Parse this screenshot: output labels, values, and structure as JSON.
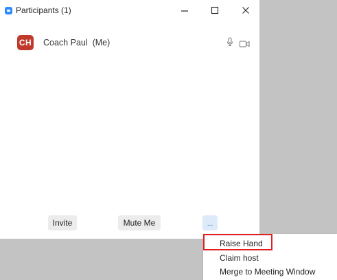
{
  "window": {
    "title": "Participants (1)",
    "controls": {
      "minimize": "minimize-icon",
      "maximize": "maximize-icon",
      "close": "close-icon"
    }
  },
  "participants": [
    {
      "initials": "CH",
      "name": "Coach Paul",
      "tag": "(Me)",
      "display": "Coach Paul  (Me)",
      "avatar_color": "#c0392b",
      "mic_icon": "microphone-icon",
      "video_icon": "video-camera-icon"
    }
  ],
  "footer": {
    "invite_label": "Invite",
    "mute_label": "Mute Me",
    "more_label": "..."
  },
  "more_menu": {
    "items": [
      {
        "label": "Raise Hand",
        "highlighted": true
      },
      {
        "label": "Claim host"
      },
      {
        "label": "Merge to Meeting Window"
      }
    ]
  },
  "colors": {
    "accent": "#2d8cff",
    "highlight_border": "#e02020",
    "background": "#c3c3c3"
  }
}
